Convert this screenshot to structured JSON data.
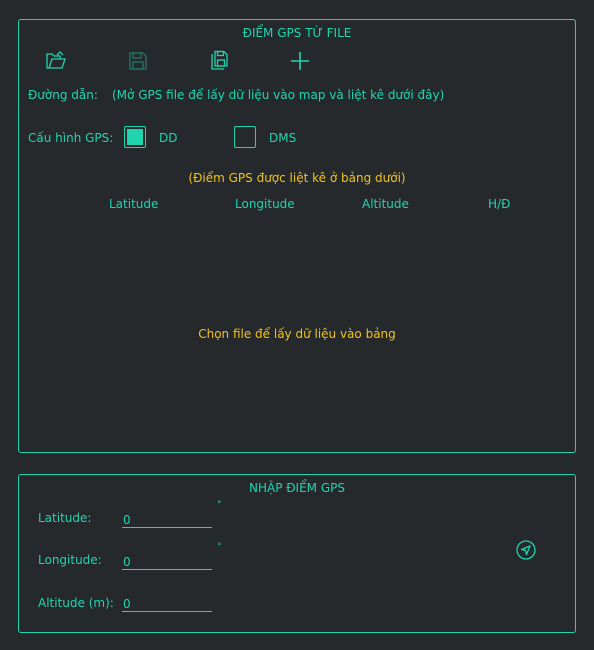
{
  "file_panel": {
    "title": "ĐIỂM GPS TỪ FILE",
    "toolbar": {
      "open_icon": "folder-open-icon",
      "save_icon": "save-icon",
      "save_as_icon": "save-copy-icon",
      "add_icon": "plus-icon"
    },
    "path_label": "Đường dẫn:",
    "path_hint": "(Mở GPS file để lấy dữ liệu vào map và liệt kê dưới đây)",
    "config_label": "Cấu hình GPS:",
    "options": [
      {
        "label": "DD",
        "checked": true
      },
      {
        "label": "DMS",
        "checked": false
      }
    ],
    "list_hint": "(Điểm GPS được liệt kê ở bảng dưới)",
    "columns": [
      "Latitude",
      "Longitude",
      "Altitude",
      "H/Đ"
    ],
    "empty_message": "Chọn file để lấy dữ liệu vào bảng"
  },
  "input_panel": {
    "title": "NHẬP ĐIỂM GPS",
    "fields": [
      {
        "label": "Latitude:",
        "value": "0",
        "unit": "°"
      },
      {
        "label": "Longitude:",
        "value": "0",
        "unit": "°"
      },
      {
        "label": "Altitude (m):",
        "value": "0",
        "unit": ""
      }
    ],
    "send_icon": "send-icon"
  },
  "colors": {
    "accent": "#1fd5b0",
    "warning": "#f1c21b",
    "background": "#26292b"
  }
}
